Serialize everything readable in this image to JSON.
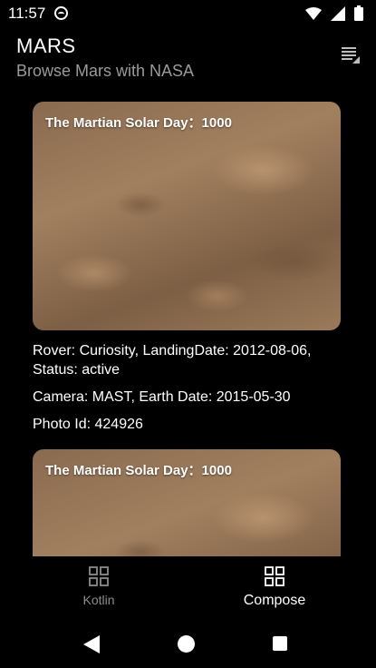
{
  "status_bar": {
    "time": "11:57",
    "icons": [
      "app-notification-icon",
      "wifi-icon",
      "signal-icon",
      "battery-icon"
    ]
  },
  "header": {
    "title": "MARS",
    "subtitle": "Browse Mars with NASA",
    "menu_icon": "sort-menu-icon"
  },
  "feed": {
    "items": [
      {
        "overlay_title": "The Martian Solar Day：1000",
        "rover_line": "Rover: Curiosity, LandingDate: 2012-08-06, Status: active",
        "camera_line": "Camera: MAST, Earth Date: 2015-05-30",
        "photo_id_line": "Photo Id: 424926"
      },
      {
        "overlay_title": "The Martian Solar Day：1000"
      }
    ]
  },
  "bottom_nav": {
    "items": [
      {
        "label": "Kotlin",
        "icon": "grid-icon",
        "selected": false
      },
      {
        "label": "Compose",
        "icon": "grid-icon",
        "selected": true
      }
    ]
  },
  "colors": {
    "background": "#000000",
    "subtitle": "#9a9a9a",
    "inactive_nav": "#8c8c8c"
  }
}
